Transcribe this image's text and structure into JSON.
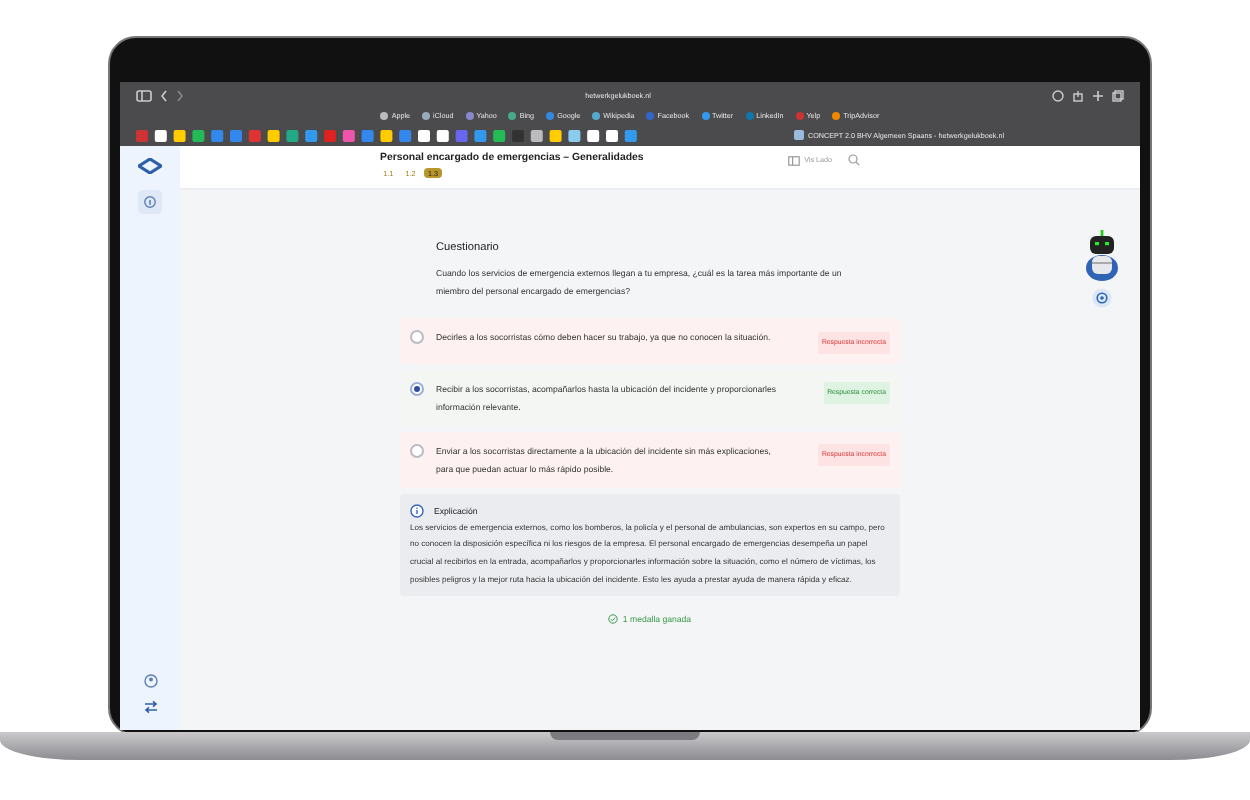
{
  "browser": {
    "url": "hetwerkgelukboek.nl",
    "tab_title": "CONCEPT 2.0 BHV Algemeen Spaans - hetwerkgelukboek.nl",
    "bookmarks": [
      "Apple",
      "iCloud",
      "Yahoo",
      "Bing",
      "Google",
      "Wikipedia",
      "Facebook",
      "Twitter",
      "LinkedIn",
      "Yelp",
      "TripAdvisor"
    ]
  },
  "header": {
    "title": "Personal encargado de emergencias – Generalidades",
    "view_label": "Vis Lado",
    "steps": [
      {
        "label": "1.1",
        "selected": false
      },
      {
        "label": "1.2",
        "selected": false
      },
      {
        "label": "1.3",
        "selected": true
      }
    ]
  },
  "quiz": {
    "title": "Cuestionario",
    "question": "Cuando los servicios de emergencia externos llegan a tu empresa, ¿cuál es la tarea más importante de un miembro del personal encargado de emergencias?",
    "options": [
      {
        "text": "Decirles a los socorristas cómo deben hacer su trabajo, ya que no conocen la situación.",
        "selected": false,
        "kind": "incorrect",
        "badge": "Respuesta incorrecta"
      },
      {
        "text": "Recibir a los socorristas, acompañarlos hasta la ubicación del incidente y proporcionarles información relevante.",
        "selected": true,
        "kind": "correct",
        "badge": "Respuesta correcta"
      },
      {
        "text": "Enviar a los socorristas directamente a la ubicación del incidente sin más explicaciones, para que puedan actuar lo más rápido posible.",
        "selected": false,
        "kind": "incorrect",
        "badge": "Respuesta incorrecta"
      }
    ]
  },
  "explanation": {
    "title": "Explicación",
    "text": "Los servicios de emergencia externos, como los bomberos, la policía y el personal de ambulancias, son expertos en su campo, pero no conocen la disposición específica ni los riesgos de la empresa. El personal encargado de emergencias desempeña un papel crucial al recibirlos en la entrada, acompañarlos y proporcionarles información sobre la situación, como el número de víctimas, los posibles peligros y la mejor ruta hacia la ubicación del incidente. Esto les ayuda a prestar ayuda de manera rápida y eficaz."
  },
  "reward": "1 medalla ganada"
}
